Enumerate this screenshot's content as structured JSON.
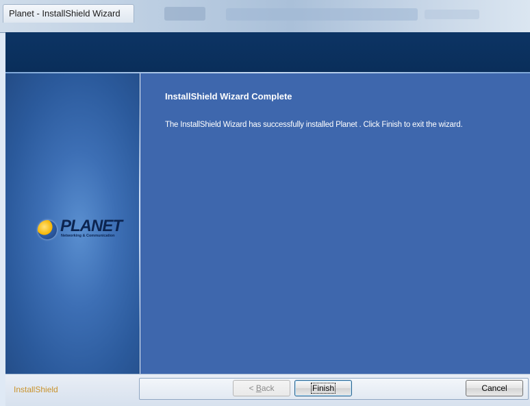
{
  "window": {
    "title": "Planet  - InstallShield Wizard"
  },
  "content": {
    "heading": "InstallShield Wizard Complete",
    "message": "The InstallShield Wizard has successfully installed Planet .  Click Finish to exit the wizard."
  },
  "logo": {
    "name": "PLANET",
    "tagline": "Networking & Communication"
  },
  "footer": {
    "brand": "InstallShield",
    "back_prefix": "< ",
    "back_mnemonic": "B",
    "back_rest": "ack",
    "finish_label": "Finish",
    "cancel_label": "Cancel"
  },
  "colors": {
    "header": "#0c3464",
    "content_panel": "#3e67ad",
    "brand_text": "#c9922a"
  }
}
